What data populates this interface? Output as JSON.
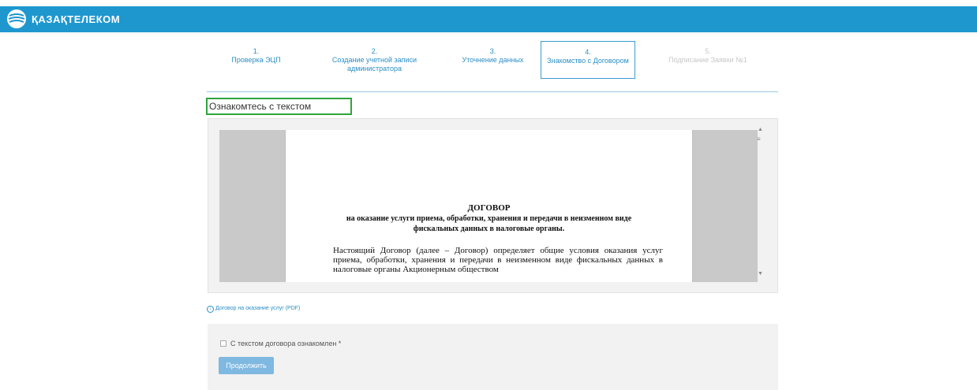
{
  "header": {
    "brand": "ҚАЗАҚТЕЛЕКОМ",
    "logo_icon": "kazakhtelecom-logo-icon"
  },
  "steps": [
    {
      "num": "1.",
      "label": "Проверка ЭЦП"
    },
    {
      "num": "2.",
      "label": "Создание учетной записи администратора"
    },
    {
      "num": "3.",
      "label": "Уточнение данных"
    },
    {
      "num": "4.",
      "label": "Знакомство с Договором"
    },
    {
      "num": "5.",
      "label": "Подписание Заявки №1"
    }
  ],
  "section": {
    "title": "Ознакомтесь с текстом договора"
  },
  "document": {
    "title": "ДОГОВОР",
    "subtitle": "на оказание услуги приема, обработки, хранения и передачи в неизменном виде фискальных данных в налоговые органы.",
    "body": "Настоящий Договор (далее – Договор) определяет общие условия оказания услуг приема, обработки, хранения и передачи в неизменном виде фискальных данных в налоговые органы Акционерным обществом"
  },
  "links": {
    "pdf": "Договор на оказание услуг (PDF)"
  },
  "agreement": {
    "checkbox_label": "С текстом договора ознакомлен *",
    "continue_button": "Продолжить"
  },
  "colors": {
    "header": "#1e97cf",
    "accent": "#2a8fc6",
    "highlight": "#2fa53b",
    "button": "#7fb8e0"
  }
}
